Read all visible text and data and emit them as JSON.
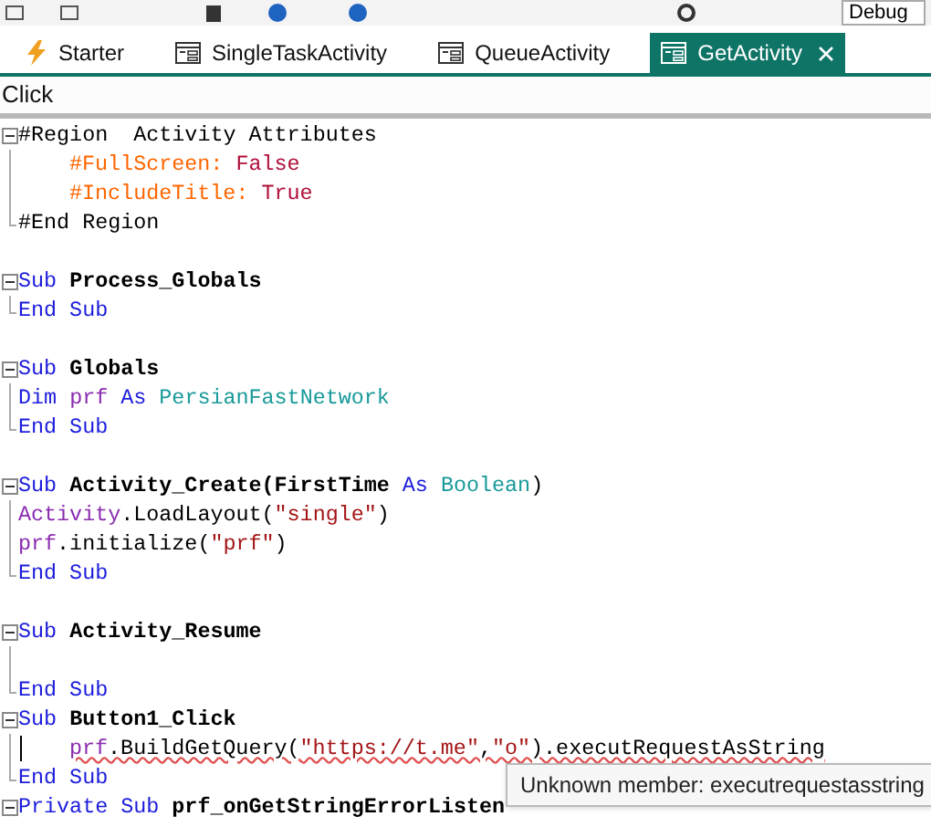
{
  "toolbar": {
    "config": "Debug"
  },
  "tabs": [
    {
      "label": "Starter",
      "kind": "service",
      "selected": false
    },
    {
      "label": "SingleTaskActivity",
      "kind": "activity",
      "selected": false
    },
    {
      "label": "QueueActivity",
      "kind": "activity",
      "selected": false
    },
    {
      "label": "GetActivity",
      "kind": "activity",
      "selected": true
    }
  ],
  "event_selector": {
    "value": "Click"
  },
  "code_lines": [
    {
      "kind": "block_start",
      "tokens": [
        {
          "t": "#Region  Activity Attributes",
          "kind": "plain"
        }
      ]
    },
    {
      "kind": "block_body",
      "indented": true,
      "tokens": [
        {
          "t": "#FullScreen: ",
          "kind": "directive"
        },
        {
          "t": "False",
          "kind": "value"
        }
      ]
    },
    {
      "kind": "block_body",
      "indented": true,
      "tokens": [
        {
          "t": "#IncludeTitle: ",
          "kind": "directive"
        },
        {
          "t": "True",
          "kind": "value"
        }
      ]
    },
    {
      "kind": "block_end",
      "tokens": [
        {
          "t": "#End Region",
          "kind": "plain"
        }
      ]
    },
    {
      "kind": "blank"
    },
    {
      "kind": "block_start",
      "tokens": [
        {
          "t": "Sub ",
          "kind": "keyword"
        },
        {
          "t": "Process_Globals",
          "kind": "name"
        }
      ]
    },
    {
      "kind": "block_end",
      "tokens": [
        {
          "t": "End Sub",
          "kind": "keyword"
        }
      ]
    },
    {
      "kind": "blank"
    },
    {
      "kind": "block_start",
      "tokens": [
        {
          "t": "Sub ",
          "kind": "keyword"
        },
        {
          "t": "Globals",
          "kind": "name"
        }
      ]
    },
    {
      "kind": "block_body",
      "tokens": [
        {
          "t": "Dim ",
          "kind": "keyword"
        },
        {
          "t": "prf",
          "kind": "object"
        },
        {
          "t": " As ",
          "kind": "keyword"
        },
        {
          "t": "PersianFastNetwork",
          "kind": "type"
        }
      ]
    },
    {
      "kind": "block_end",
      "tokens": [
        {
          "t": "End Sub",
          "kind": "keyword"
        }
      ]
    },
    {
      "kind": "blank"
    },
    {
      "kind": "block_start",
      "tokens": [
        {
          "t": "Sub ",
          "kind": "keyword"
        },
        {
          "t": "Activity_Create(FirstTime ",
          "kind": "name"
        },
        {
          "t": "As ",
          "kind": "keyword"
        },
        {
          "t": "Boolean",
          "kind": "type"
        },
        {
          "t": ")",
          "kind": "plain"
        }
      ]
    },
    {
      "kind": "block_body",
      "tokens": [
        {
          "t": "Activity",
          "kind": "object"
        },
        {
          "t": ".LoadLayout(",
          "kind": "plain"
        },
        {
          "t": "\"single\"",
          "kind": "string"
        },
        {
          "t": ")",
          "kind": "plain"
        }
      ]
    },
    {
      "kind": "block_body",
      "tokens": [
        {
          "t": "prf",
          "kind": "object"
        },
        {
          "t": ".initialize(",
          "kind": "plain"
        },
        {
          "t": "\"prf\"",
          "kind": "string"
        },
        {
          "t": ")",
          "kind": "plain"
        }
      ]
    },
    {
      "kind": "block_end",
      "tokens": [
        {
          "t": "End Sub",
          "kind": "keyword"
        }
      ]
    },
    {
      "kind": "blank"
    },
    {
      "kind": "block_start",
      "tokens": [
        {
          "t": "Sub ",
          "kind": "keyword"
        },
        {
          "t": "Activity_Resume",
          "kind": "name"
        }
      ]
    },
    {
      "kind": "block_body"
    },
    {
      "kind": "block_end",
      "tokens": [
        {
          "t": "End Sub",
          "kind": "keyword"
        }
      ]
    },
    {
      "kind": "block_start",
      "tokens": [
        {
          "t": "Sub ",
          "kind": "keyword"
        },
        {
          "t": "Button1_Click",
          "kind": "name"
        }
      ]
    },
    {
      "kind": "block_body",
      "indented": true,
      "caret": true,
      "tokens": [
        {
          "t": "prf",
          "kind": "error_object"
        },
        {
          "t": ".BuildGetQuery(",
          "kind": "error"
        },
        {
          "t": "\"https://t.me\"",
          "kind": "error_string"
        },
        {
          "t": ",",
          "kind": "error"
        },
        {
          "t": "\"o\"",
          "kind": "error_string"
        },
        {
          "t": ").executRequestAsString",
          "kind": "error"
        }
      ]
    },
    {
      "kind": "block_end",
      "tokens": [
        {
          "t": "End Sub",
          "kind": "keyword"
        }
      ]
    },
    {
      "kind": "block_start",
      "tokens": [
        {
          "t": "Private Sub ",
          "kind": "keyword"
        },
        {
          "t": "prf_onGetStringErrorListen",
          "kind": "name"
        }
      ]
    }
  ],
  "tooltip": {
    "text": "Unknown member: executrequestasstring"
  }
}
